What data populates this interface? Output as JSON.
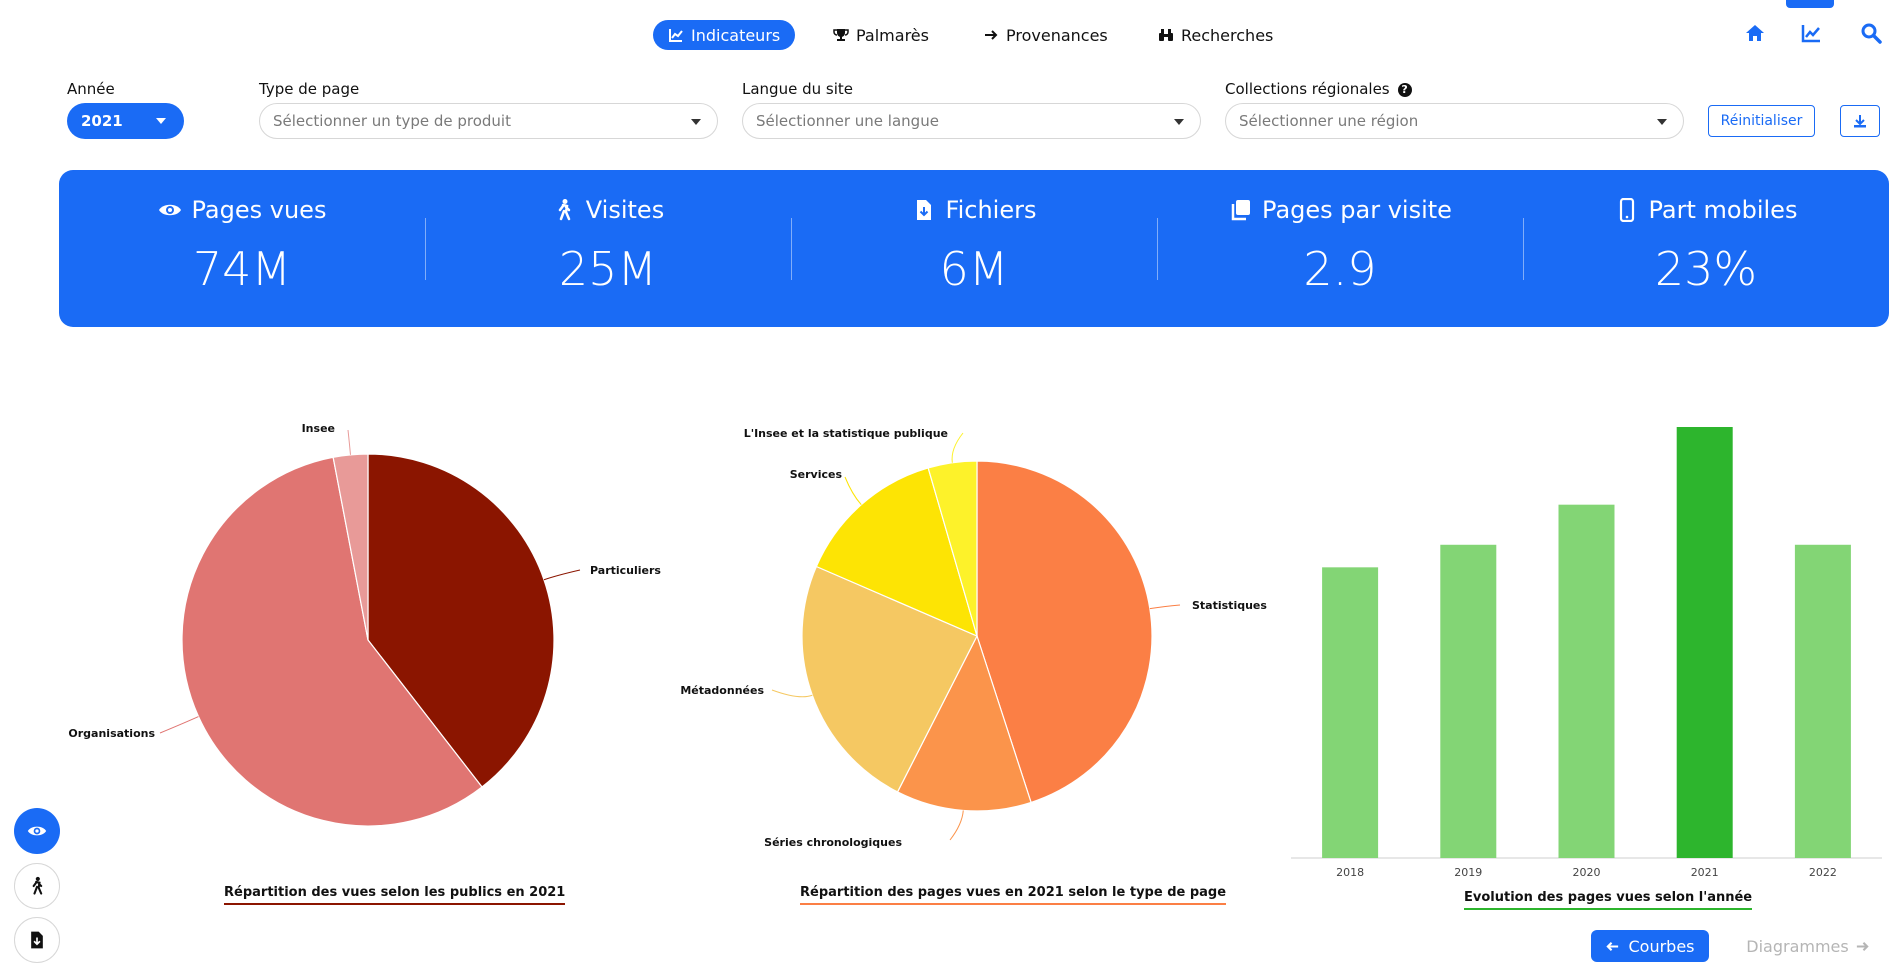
{
  "nav": {
    "items": [
      {
        "label": "Indicateurs",
        "icon": "chart-line-icon",
        "active": true
      },
      {
        "label": "Palmarès",
        "icon": "trophy-icon",
        "active": false
      },
      {
        "label": "Provenances",
        "icon": "arrow-right-icon",
        "active": false
      },
      {
        "label": "Recherches",
        "icon": "binoculars-icon",
        "active": false
      }
    ],
    "right_icons": [
      "home-icon",
      "chart-line-icon",
      "search-icon"
    ]
  },
  "filters": {
    "year": {
      "label": "Année",
      "value": "2021"
    },
    "page_type": {
      "label": "Type de page",
      "placeholder": "Sélectionner un type de produit"
    },
    "language": {
      "label": "Langue du site",
      "placeholder": "Sélectionner une langue"
    },
    "region": {
      "label": "Collections régionales",
      "placeholder": "Sélectionner une région"
    },
    "reset_label": "Réinitialiser",
    "download_icon": "download-icon"
  },
  "kpis": [
    {
      "title": "Pages vues",
      "value": "74M",
      "icon": "eye-icon"
    },
    {
      "title": "Visites",
      "value": "25M",
      "icon": "walking-icon"
    },
    {
      "title": "Fichiers",
      "value": "6M",
      "icon": "file-download-icon"
    },
    {
      "title": "Pages par visite",
      "value": "2.9",
      "icon": "copy-icon"
    },
    {
      "title": "Part mobiles",
      "value": "23%",
      "icon": "mobile-icon"
    }
  ],
  "chart_data": [
    {
      "type": "pie",
      "title": "Répartition des vues selon les publics en 2021",
      "slices": [
        {
          "label": "Particuliers",
          "value": 39.5,
          "color": "#8b1500"
        },
        {
          "label": "Organisations",
          "value": 57.5,
          "color": "#e07572"
        },
        {
          "label": "Insee",
          "value": 3.0,
          "color": "#e89a98"
        }
      ],
      "underline_color": "#8b1500"
    },
    {
      "type": "pie",
      "title": "Répartition des pages vues en 2021 selon le type de page",
      "slices": [
        {
          "label": "Statistiques",
          "value": 45.0,
          "color": "#fb7f45"
        },
        {
          "label": "Séries chronologiques",
          "value": 12.5,
          "color": "#fb944b"
        },
        {
          "label": "Métadonnées",
          "value": 24.0,
          "color": "#f5c862"
        },
        {
          "label": "Services",
          "value": 14.0,
          "color": "#fde404"
        },
        {
          "label": "L'Insee et la statistique publique",
          "value": 4.5,
          "color": "#fdf22a"
        }
      ],
      "underline_color": "#fb7f45"
    },
    {
      "type": "bar",
      "title": "Evolution des pages vues selon l'année",
      "categories": [
        "2018",
        "2019",
        "2020",
        "2021",
        "2022"
      ],
      "values": [
        58,
        62.5,
        70.5,
        86,
        62.5
      ],
      "ylim": [
        0,
        86
      ],
      "colors": [
        "#83d575",
        "#83d575",
        "#83d575",
        "#2db52d",
        "#83d575"
      ],
      "underline_color": "#2db52d"
    }
  ],
  "side_buttons": [
    {
      "icon": "eye-icon",
      "active": true
    },
    {
      "icon": "walking-icon",
      "active": false
    },
    {
      "icon": "file-download-icon",
      "active": false
    }
  ],
  "bottom": {
    "courbes_label": "Courbes",
    "diagrammes_label": "Diagrammes"
  }
}
